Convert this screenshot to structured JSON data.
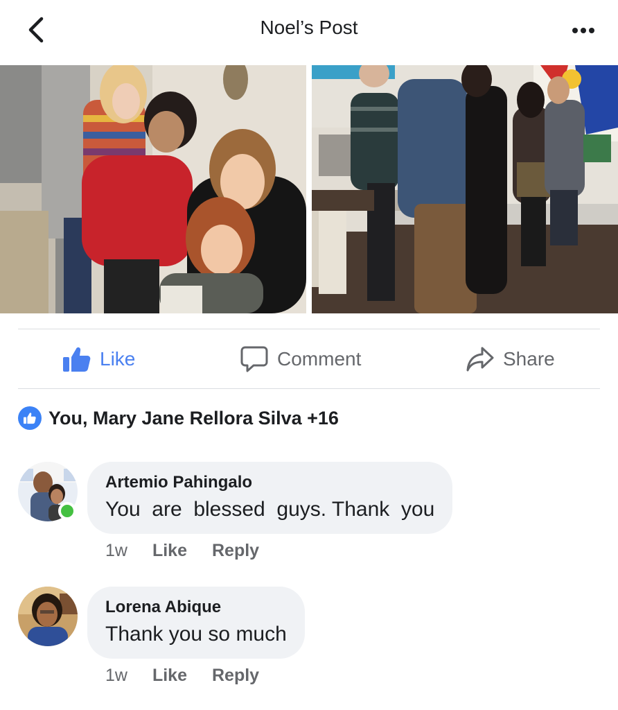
{
  "header": {
    "title": "Noel’s Post",
    "back_icon": "chevron-left-icon",
    "more_icon": "more-horizontal-icon"
  },
  "actions": {
    "like_label": "Like",
    "comment_label": "Comment",
    "share_label": "Share",
    "like_color": "#4a80f0",
    "muted_color": "#65676b"
  },
  "reactions": {
    "text": "You, Mary Jane Rellora Silva +16",
    "icon": "thumbs-up-icon"
  },
  "comments": [
    {
      "author": "Artemio Pahingalo",
      "text": "You  are  blessed  guys. Thank  you",
      "age": "1w",
      "like_label": "Like",
      "reply_label": "Reply",
      "online": true
    },
    {
      "author": "Lorena Abique",
      "text": "Thank you so much",
      "age": "1w",
      "like_label": "Like",
      "reply_label": "Reply",
      "online": false
    }
  ],
  "colors": {
    "accent": "#4a80f0",
    "bubble": "#f0f2f5",
    "online": "#44c041",
    "divider": "#dadde1"
  }
}
